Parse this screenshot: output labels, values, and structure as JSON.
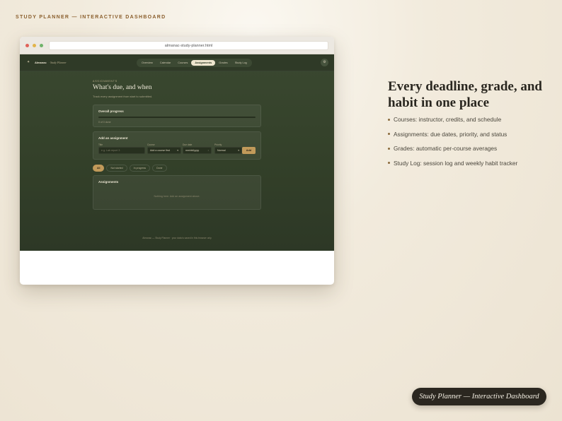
{
  "page_label": "STUDY PLANNER — INTERACTIVE DASHBOARD",
  "browser": {
    "url": "almanac-study-planner.html"
  },
  "app": {
    "brand_icon": "✦",
    "brand_name": "Almanac",
    "brand_subtitle": "· Study Planner",
    "tabs": [
      {
        "label": "Overview"
      },
      {
        "label": "Calendar"
      },
      {
        "label": "Courses"
      },
      {
        "label": "Assignments",
        "active": true
      },
      {
        "label": "Grades"
      },
      {
        "label": "Study Log"
      }
    ],
    "settings_icon": "⚙",
    "section": {
      "eyebrow": "ASSIGNMENTS",
      "title": "What's due, and when",
      "subtitle": "Track every assignment from start to submitted."
    },
    "progress": {
      "title": "Overall progress",
      "fraction": 0,
      "text": "0 of 0 done"
    },
    "add_form": {
      "title": "Add an assignment",
      "title_label": "Title",
      "title_placeholder": "e.g. Lab report 3",
      "course_label": "Course",
      "course_value": "Add a course first",
      "due_label": "Due date",
      "due_value": "mm/dd/yyyy",
      "priority_label": "Priority",
      "priority_value": "Normal",
      "add_label": "Add"
    },
    "filters": [
      {
        "label": "All",
        "active": true
      },
      {
        "label": "Not started"
      },
      {
        "label": "In progress"
      },
      {
        "label": "Done"
      }
    ],
    "list": {
      "title": "Assignments",
      "empty_text": "Nothing here. Add an assignment above."
    },
    "footer": "Almanac — Study Planner · your data is saved in this browser only"
  },
  "marketing": {
    "headline": "Every deadline, grade, and habit in one place",
    "features": [
      "Courses: instructor, credits, and schedule",
      "Assignments: due dates, priority, and status",
      "Grades: automatic per-course averages",
      "Study Log: session log and weekly habit tracker"
    ]
  },
  "caption": "Study Planner — Interactive Dashboard"
}
